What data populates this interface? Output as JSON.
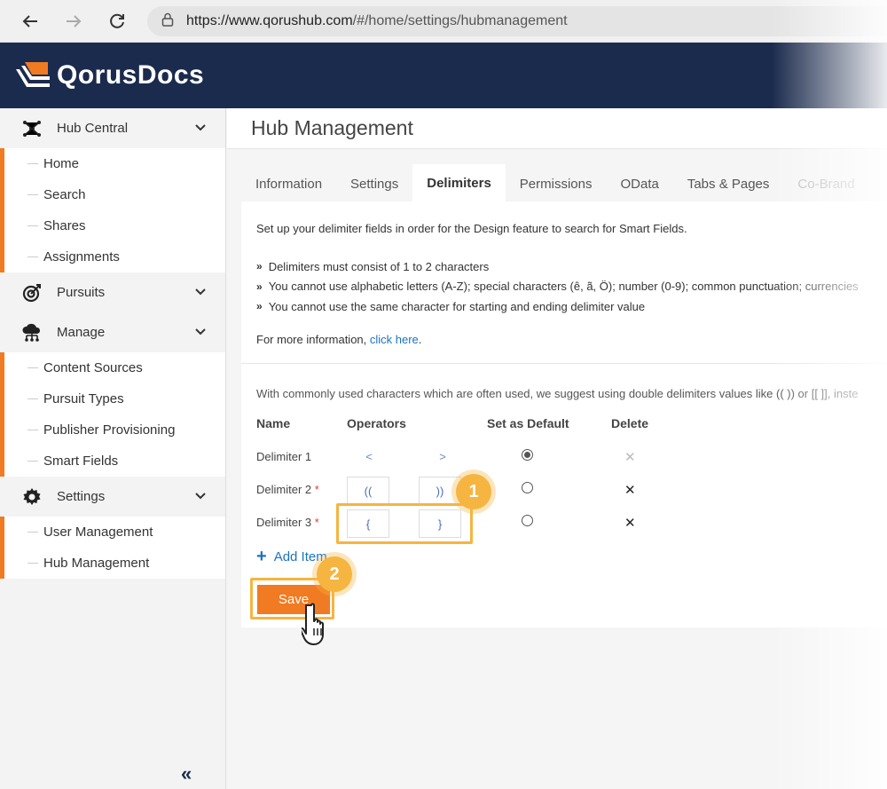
{
  "browser": {
    "url_domain": "https://www.qorushub.com",
    "url_path": "/#/home/settings/hubmanagement"
  },
  "app": {
    "name": "QorusDocs"
  },
  "sidebar": {
    "groups": [
      {
        "label": "Hub Central",
        "icon": "hub-network-icon",
        "items": [
          "Home",
          "Search",
          "Shares",
          "Assignments"
        ]
      },
      {
        "label": "Pursuits",
        "icon": "target-icon",
        "items": []
      },
      {
        "label": "Manage",
        "icon": "cloud-network-icon",
        "items": [
          "Content Sources",
          "Pursuit Types",
          "Publisher Provisioning",
          "Smart Fields"
        ]
      },
      {
        "label": "Settings",
        "icon": "gear-icon",
        "items": [
          "User Management",
          "Hub Management"
        ]
      }
    ],
    "collapse_label": "«"
  },
  "page": {
    "title": "Hub Management",
    "tabs": [
      "Information",
      "Settings",
      "Delimiters",
      "Permissions",
      "OData",
      "Tabs & Pages",
      "Co-Brand"
    ],
    "active_tab": "Delimiters"
  },
  "delimiters": {
    "intro": "Set up your delimiter fields in order for the Design feature to search for Smart Fields.",
    "rules": [
      "Delimiters must consist of 1 to 2 characters",
      "You cannot use alphabetic letters (A-Z); special characters (ê, ã, Ö); number (0-9); common punctuation; currencies",
      "You cannot use the same character for starting and ending delimiter value"
    ],
    "more_info_prefix": "For more information, ",
    "more_info_link": "click here",
    "more_info_suffix": ".",
    "suggestion": "With commonly used characters which are often used, we suggest using double delimiters values like (( )) or [[ ]], inste",
    "columns": {
      "name": "Name",
      "operators": "Operators",
      "default": "Set as Default",
      "delete": "Delete"
    },
    "rows": [
      {
        "name": "Delimiter 1",
        "required": "",
        "start": "<",
        "end": ">"
      },
      {
        "name": "Delimiter 2",
        "required": "*",
        "start": "((",
        "end": "))"
      },
      {
        "name": "Delimiter 3",
        "required": "*",
        "start": "{",
        "end": "}"
      }
    ],
    "delete_symbol": "✕",
    "add_item": "Add Item",
    "save": "Save"
  },
  "callouts": {
    "step1": "1",
    "step2": "2"
  },
  "colors": {
    "accent": "#f07b22",
    "header": "#1b2b4d",
    "callout": "#f5b540",
    "link": "#1a73c0"
  }
}
